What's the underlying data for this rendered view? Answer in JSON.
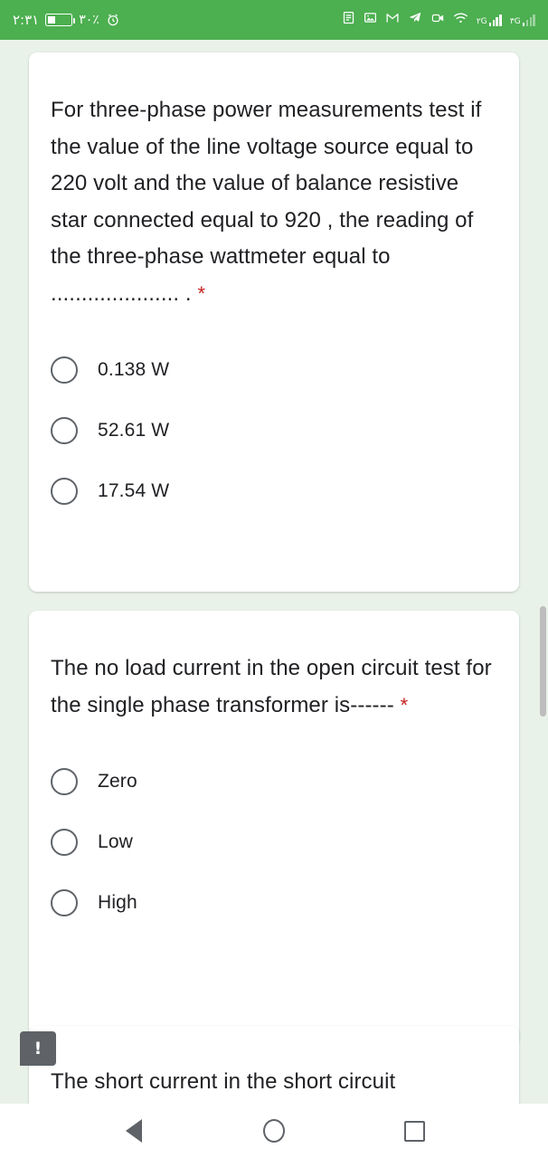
{
  "statusbar": {
    "time": "٢:٣١",
    "battery_percent": "٣٠٪",
    "icons": {
      "battery": "battery-icon",
      "alarm": "alarm-clock-icon",
      "notes": "notes-icon",
      "photos": "photos-icon",
      "gmail": "gmail-icon",
      "telegram": "telegram-icon",
      "camera": "video-camera-icon",
      "wifi": "wifi-icon",
      "sim1": "٢G",
      "sim2": "٣G"
    }
  },
  "cards": [
    {
      "question": "For three-phase power measurements test if the value of the line voltage source equal to 220 volt and the value of balance resistive star connected equal to 920 , the reading of the three-phase wattmeter equal to ..................... .",
      "required_marker": "*",
      "options": [
        "0.138 W",
        "52.61 W",
        "17.54 W"
      ]
    },
    {
      "question": "The no load current in the open circuit test for the single phase transformer is------",
      "required_marker": "*",
      "options": [
        "Zero",
        "Low",
        "High"
      ]
    },
    {
      "question": "The short current in the short circuit",
      "required_marker": "",
      "options": []
    }
  ],
  "warning_badge": {
    "symbol": "!"
  },
  "navbar": {
    "back": "back-button",
    "home": "home-button",
    "recents": "recents-button"
  },
  "colors": {
    "accent_green": "#4caf50",
    "page_background": "#e9f2e9",
    "card": "#ffffff",
    "required_red": "#c5221f",
    "text": "#202124",
    "icon_gray": "#5f6368"
  }
}
